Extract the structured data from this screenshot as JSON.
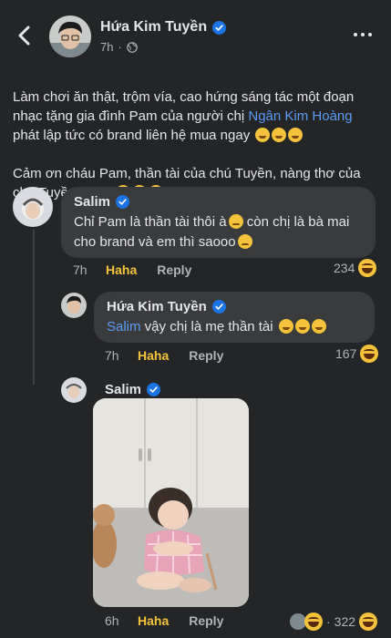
{
  "header": {
    "name": "Hứa Kim Tuyền",
    "time": "7h"
  },
  "post": {
    "paragraph1_before": "Làm chơi ăn thật, trộm vía, cao hứng sáng tác một đoạn nhạc tặng gia đình Pam của người chị ",
    "mention": "Ngân Kim Hoàng",
    "paragraph1_after": " phát lập tức có brand liên hệ mua ngay",
    "paragraph2": "Cảm ơn cháu Pam, thần tài của chú Tuyền, nàng thơ của chú Tuyền nháa"
  },
  "comments": [
    {
      "name": "Salim",
      "text_line1": "Chỉ Pam là thần tài thôi à",
      "text_line1_after": " còn chị là bà mai",
      "text_line2": "cho brand và em thì saooo",
      "time": "7h",
      "reaction": "Haha",
      "reply": "Reply",
      "count": "234"
    },
    {
      "name": "Hứa Kim Tuyền",
      "mention": "Salim",
      "text": " vậy chị là mẹ thần tài",
      "time": "7h",
      "reaction": "Haha",
      "reply": "Reply",
      "count": "167"
    },
    {
      "name": "Salim",
      "time": "6h",
      "reaction": "Haha",
      "reply": "Reply",
      "count": "322"
    }
  ],
  "colors": {
    "background": "#242526",
    "bubble": "#3a3b3c",
    "link": "#5a9cf5",
    "haha": "#f5c33b",
    "verified": "#1b74e4"
  }
}
